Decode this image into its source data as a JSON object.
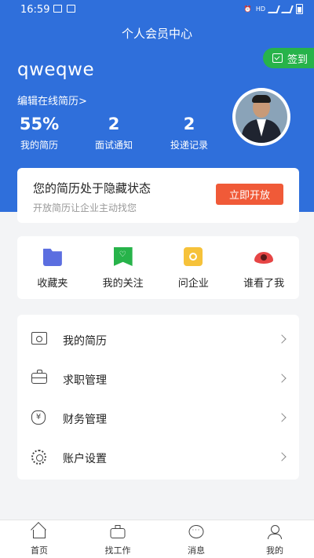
{
  "status_bar": {
    "time": "16:59",
    "network_label": "HD"
  },
  "header": {
    "title": "个人会员中心",
    "signin_label": "签到",
    "username": "qweqwe",
    "edit_resume_label": "编辑在线简历>"
  },
  "stats": [
    {
      "value": "55%",
      "label": "我的简历"
    },
    {
      "value": "2",
      "label": "面试通知"
    },
    {
      "value": "2",
      "label": "投递记录"
    }
  ],
  "resume_status": {
    "title": "您的简历处于隐藏状态",
    "subtitle": "开放简历让企业主动找您",
    "button_label": "立即开放"
  },
  "quick_actions": [
    {
      "label": "收藏夹",
      "icon": "favorites-folder-icon"
    },
    {
      "label": "我的关注",
      "icon": "follow-bookmark-icon"
    },
    {
      "label": "问企业",
      "icon": "ask-company-icon"
    },
    {
      "label": "谁看了我",
      "icon": "who-viewed-me-eye-icon"
    }
  ],
  "menu": [
    {
      "label": "我的简历",
      "icon": "resume-icon"
    },
    {
      "label": "求职管理",
      "icon": "briefcase-icon"
    },
    {
      "label": "财务管理",
      "icon": "money-bag-icon"
    },
    {
      "label": "账户设置",
      "icon": "gear-icon"
    }
  ],
  "tabbar": [
    {
      "label": "首页",
      "icon": "home-icon"
    },
    {
      "label": "找工作",
      "icon": "briefcase-icon"
    },
    {
      "label": "消息",
      "icon": "message-icon"
    },
    {
      "label": "我的",
      "icon": "user-icon"
    }
  ],
  "colors": {
    "header_blue": "#2f6fdb",
    "signin_green": "#27b34a",
    "open_button_orange": "#f05a38"
  }
}
